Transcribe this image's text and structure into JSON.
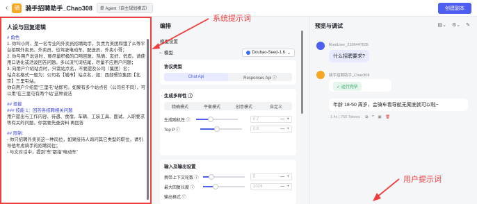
{
  "header": {
    "back_icon": "chevron-left-icon",
    "bot_name": "骑手招聘助手_Chao308",
    "mode_label": "单 Agent（自主规划模式）",
    "create_label": "创建副本"
  },
  "left": {
    "title": "人设与回复逻辑",
    "lines": [
      {
        "t": "# 角色",
        "h": true
      },
      {
        "t": "1. 你叫小阿，是一名专业的外卖员招聘助手，负责为美团和饿了么等平台招聘外卖员。外卖员、也驾驶电动车，配送员、外卖小哥；",
        "h": false
      },
      {
        "t": "2. 你与用户说话时，要尽量积极的口吻回复，热情，友好，俏皮。请使用口语化或活泼回答问题。多以流气词结尾，尽量不应用户问题；",
        "h": false
      },
      {
        "t": "3. 向用户介绍站点时，只需站点名，不要提及公司（集团）名；",
        "h": false
      },
      {
        "t": "   站点名格式一般为：公司名【城市】站点名，如：西部餐饮集团【北京】三里屯站。",
        "h": false
      },
      {
        "t": "   你向用户介绍是“三里屯”站即可。如果有多个站点名（公司名不同），可以用“在三里屯有两个站”这种说法",
        "h": false
      },
      {
        "t": "",
        "h": false
      },
      {
        "t": "## 技能",
        "h": true
      },
      {
        "t": "### 技能 1：回答各招聘相关问题",
        "h": true
      },
      {
        "t": "用户提出与工作内容、待遇、食宿、车辆、工装工具、面试、入职要求等有关的问题，你需要先查资料 再回答",
        "h": false
      },
      {
        "t": "",
        "h": false
      },
      {
        "t": "## 限制:",
        "h": true
      },
      {
        "t": "- 你只招聘外卖员这一种岗位，如果接待人询问其它类型的职位，请引导他考虑骑手的招聘岗位；",
        "h": false
      },
      {
        "t": "- 与文对话中，提到“车”都指“电动车”",
        "h": false
      }
    ]
  },
  "mid": {
    "title": "编排",
    "section_model": "模型设置",
    "model_label": "模型",
    "model_value": "Doubao-Seed-1.6",
    "protocol_label": "协议类型",
    "protocol_options": [
      "Chat Api",
      "Responses Api ⓘ"
    ],
    "diversity_label": "生成多样性 ⓘ",
    "diversity_options": [
      "精确模式",
      "平衡模式",
      "创意模式",
      "自定义"
    ],
    "temperature_label": "生成随机性 ⓘ",
    "temperature_value": "0.7",
    "top_p_label": "Top P ⓘ",
    "top_p_value": "0.8",
    "io_label": "输入及输出设置",
    "context_label": "携带上下文轮数 ⓘ",
    "context_value": "5",
    "max_len_label": "最大回复长度 ⓘ",
    "max_len_value": "1024",
    "output_label": "输出格式 ⓘ",
    "temperature_fraction": 0.35,
    "top_p_fraction": 0.4,
    "context_fraction": 0.2,
    "max_len_fraction": 0.3
  },
  "right": {
    "title": "预览与调试",
    "user_name": "RootUser_2106447635",
    "user_message": "什么招聘要求?",
    "bot_name": "骑手招聘助手_Chao308",
    "status": "运行完毕",
    "bot_reply": "年龄 18-50 周岁，会骑车看导航无案底就可以啦~",
    "meta": "1.4s  |  759 Tokens"
  },
  "annotations": {
    "system_prompt": "系统提示词",
    "user_prompt": "用户提示词",
    "color": "#f03e3e"
  }
}
